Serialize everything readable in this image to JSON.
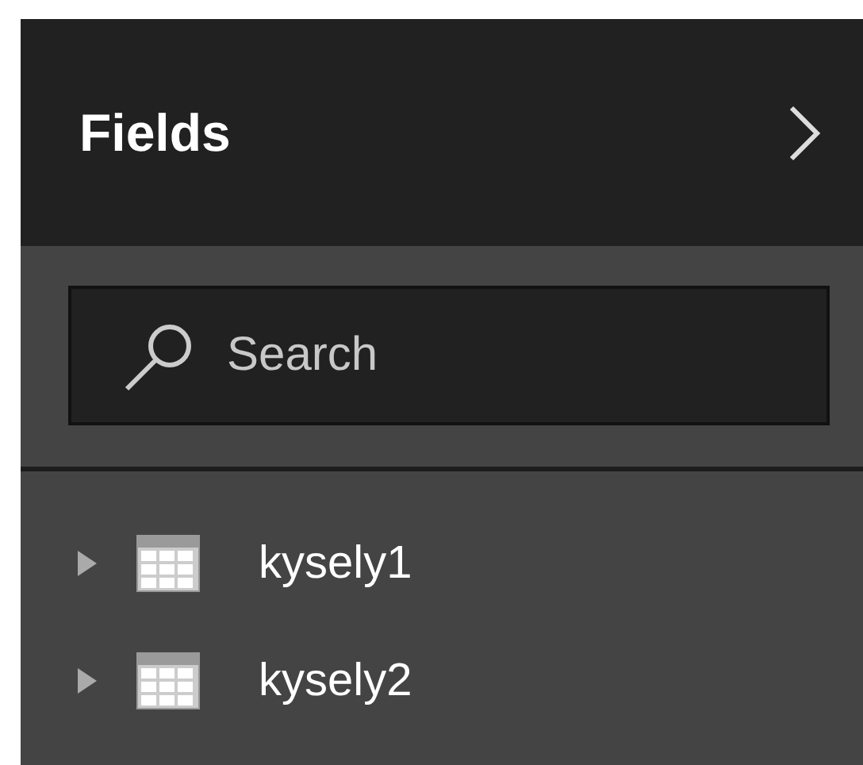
{
  "panel": {
    "title": "Fields"
  },
  "search": {
    "placeholder": "Search"
  },
  "tables": [
    {
      "name": "kysely1",
      "expanded": false
    },
    {
      "name": "kysely2",
      "expanded": false
    }
  ]
}
